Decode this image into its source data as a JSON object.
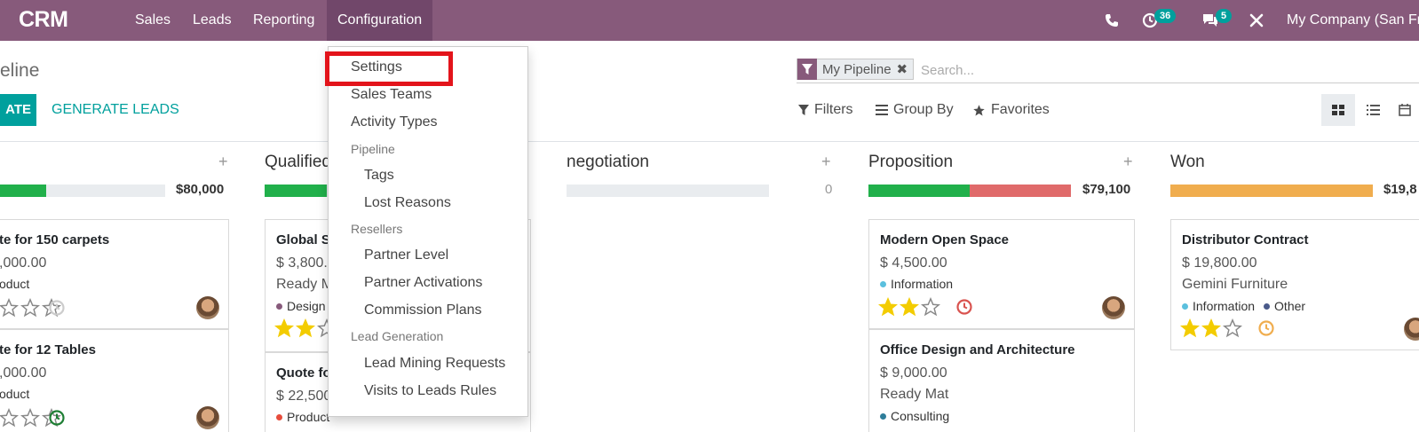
{
  "app": {
    "brand": "CRM"
  },
  "nav": {
    "menu": [
      "Sales",
      "Leads",
      "Reporting",
      "Configuration"
    ],
    "activity_count": "36",
    "messages_count": "5",
    "company": "My Company (San Fr"
  },
  "control": {
    "breadcrumb": "eline",
    "create_label": "ATE",
    "generate_label": "GENERATE LEADS",
    "facet_label": "My Pipeline",
    "search_placeholder": "Search...",
    "filters_label": "Filters",
    "groupby_label": "Group By",
    "favorites_label": "Favorites"
  },
  "dropdown": {
    "items": [
      {
        "kind": "item",
        "label": "Settings",
        "indent": false
      },
      {
        "kind": "item",
        "label": "Sales Teams",
        "indent": false
      },
      {
        "kind": "item",
        "label": "Activity Types",
        "indent": false
      },
      {
        "kind": "header",
        "label": "Pipeline"
      },
      {
        "kind": "item",
        "label": "Tags",
        "indent": true
      },
      {
        "kind": "item",
        "label": "Lost Reasons",
        "indent": true
      },
      {
        "kind": "header",
        "label": "Resellers"
      },
      {
        "kind": "item",
        "label": "Partner Level",
        "indent": true
      },
      {
        "kind": "item",
        "label": "Partner Activations",
        "indent": true
      },
      {
        "kind": "item",
        "label": "Commission Plans",
        "indent": true
      },
      {
        "kind": "header",
        "label": "Lead Generation"
      },
      {
        "kind": "item",
        "label": "Lead Mining Requests",
        "indent": true
      },
      {
        "kind": "item",
        "label": "Visits to Leads Rules",
        "indent": true
      }
    ]
  },
  "kanban": {
    "columns": [
      {
        "title": "",
        "sum": "$80,000",
        "progress": [
          {
            "color": "#21b04b",
            "fraction": 0.28
          }
        ]
      },
      {
        "title": "Qualified",
        "sum": "",
        "progress": [
          {
            "color": "#21b04b",
            "fraction": 0.5
          }
        ]
      },
      {
        "title": "negotiation",
        "sum": "0",
        "progress": []
      },
      {
        "title": "Proposition",
        "sum": "$79,100",
        "progress": [
          {
            "color": "#21b04b",
            "fraction": 0.5
          },
          {
            "color": "#e06a6a",
            "fraction": 0.5
          }
        ]
      },
      {
        "title": "Won",
        "sum": "$19,8",
        "progress": [
          {
            "color": "#f0ad4e",
            "fraction": 1.0
          }
        ]
      }
    ],
    "cards": [
      {
        "title": "te for 150 carpets",
        "revenue": ",000.00",
        "company": "",
        "tags": [
          {
            "label": "oduct",
            "color": ""
          }
        ],
        "stars": 0,
        "activity_color": "#cccccc"
      },
      {
        "title": "te for 12 Tables",
        "revenue": ",000.00",
        "company": "",
        "tags": [
          {
            "label": "oduct",
            "color": ""
          }
        ],
        "stars": 0,
        "activity_color": "#1e7e34"
      },
      {
        "title": "Global S",
        "revenue": "$ 3,800.0",
        "company": "Ready M",
        "tags": [
          {
            "label": "Design",
            "color": "#875a7b"
          }
        ],
        "stars": 2,
        "activity_color": ""
      },
      {
        "title": "Quote fo",
        "revenue": "$ 22,500",
        "company": "",
        "tags": [
          {
            "label": "Product",
            "color": "#e74c3c"
          }
        ],
        "stars": 0,
        "activity_color": ""
      },
      {
        "title": "Modern Open Space",
        "revenue": "$ 4,500.00",
        "company": "",
        "tags": [
          {
            "label": "Information",
            "color": "#5bc0de"
          }
        ],
        "stars": 2,
        "activity_color": "#d9534f"
      },
      {
        "title": "Office Design and Architecture",
        "revenue": "$ 9,000.00",
        "company": "Ready Mat",
        "tags": [
          {
            "label": "Consulting",
            "color": "#2e7d9a"
          }
        ],
        "stars": 0,
        "activity_color": ""
      },
      {
        "title": "Distributor Contract",
        "revenue": "$ 19,800.00",
        "company": "Gemini Furniture",
        "tags": [
          {
            "label": "Information",
            "color": "#5bc0de"
          },
          {
            "label": "Other",
            "color": "#4a5a8a"
          }
        ],
        "stars": 2,
        "activity_color": "#f0ad4e"
      }
    ]
  },
  "colors": {
    "navbar": "#875a7b",
    "accent": "#00a09d",
    "highlight": "#e3141b"
  }
}
